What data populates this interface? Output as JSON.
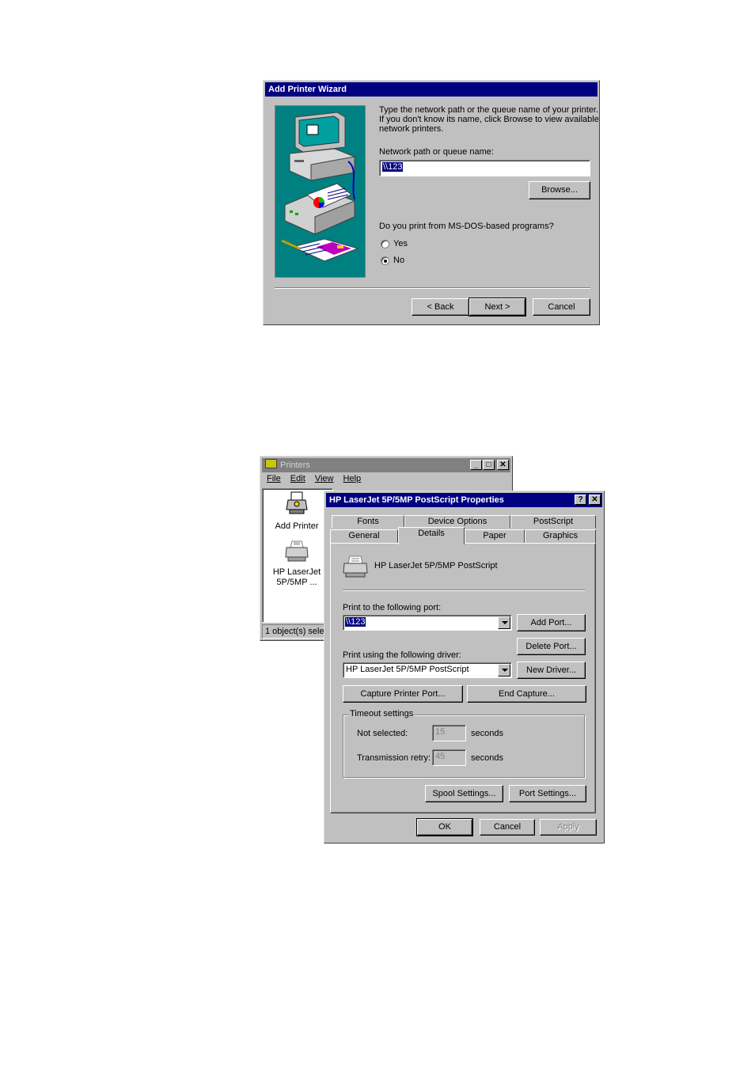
{
  "wizard": {
    "title": "Add Printer Wizard",
    "instructions_line1": "Type the network path or the queue name of your printer.",
    "instructions_line2": "If you don't know its name, click Browse to view available",
    "instructions_line3": "network printers.",
    "path_label": "Network path or queue name:",
    "path_value": "\\\\123",
    "browse_label": "Browse...",
    "msdos_question": "Do you print from MS-DOS-based programs?",
    "radio_yes": "Yes",
    "radio_no": "No",
    "selected_option": "No",
    "back_label": "< Back",
    "next_label": "Next >",
    "cancel_label": "Cancel"
  },
  "printers_window": {
    "title": "Printers",
    "menu": [
      "File",
      "Edit",
      "View",
      "Help"
    ],
    "items": [
      {
        "label": "Add Printer"
      },
      {
        "label_line1": "HP LaserJet",
        "label_line2": "5P/5MP ..."
      }
    ],
    "status": "1 object(s) selec"
  },
  "properties": {
    "title": "HP LaserJet 5P/5MP PostScript Properties",
    "tabs_back": [
      "Fonts",
      "Device Options",
      "PostScript"
    ],
    "tabs_front": [
      "General",
      "Details",
      "Paper",
      "Graphics"
    ],
    "active_tab": "Details",
    "printer_name": "HP LaserJet 5P/5MP PostScript",
    "port_label": "Print to the following port:",
    "port_value": "\\\\123",
    "add_port": "Add Port...",
    "delete_port": "Delete Port...",
    "driver_label": "Print using the following driver:",
    "driver_value": "HP LaserJet 5P/5MP PostScript",
    "new_driver": "New Driver...",
    "capture_port": "Capture Printer Port...",
    "end_capture": "End Capture...",
    "timeout_group": "Timeout settings",
    "not_selected_label": "Not selected:",
    "not_selected_value": "15",
    "transmission_label": "Transmission retry:",
    "transmission_value": "45",
    "seconds": "seconds",
    "spool_settings": "Spool Settings...",
    "port_settings": "Port Settings...",
    "ok": "OK",
    "cancel": "Cancel",
    "apply": "Apply"
  }
}
